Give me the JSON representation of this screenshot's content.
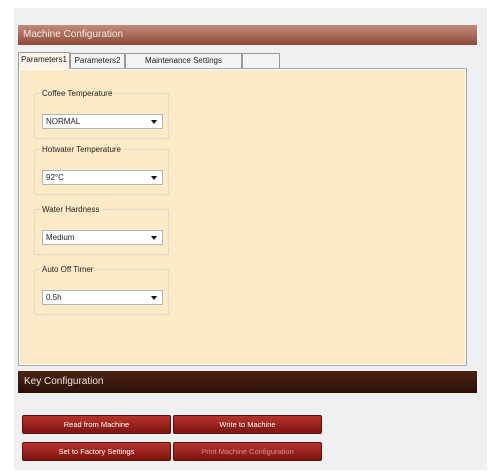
{
  "window": {
    "title": "Machine Configuration"
  },
  "tabs": [
    {
      "label": "Parameters1",
      "active": true
    },
    {
      "label": "Parameters2",
      "active": false
    },
    {
      "label": "Maintenance Settings",
      "active": false
    }
  ],
  "groups": [
    {
      "label": "Coffee Temperature",
      "value": "NORMAL"
    },
    {
      "label": "Hotwater Temperature",
      "value": "92°C"
    },
    {
      "label": "Water Hardness",
      "value": "Medium"
    },
    {
      "label": "Auto Off Timer",
      "value": "0.5h"
    }
  ],
  "key_section": {
    "title": "Key Configuration"
  },
  "buttons": {
    "read": "Read from Machine",
    "write": "Write to Machine",
    "factory": "Set to Factory Settings",
    "print": "Print Machine Configuration"
  },
  "colors": {
    "title_bar": "#a45f4d",
    "panel_bg": "#fdebc8",
    "key_bar": "#3a180c",
    "button": "#9e211c"
  }
}
